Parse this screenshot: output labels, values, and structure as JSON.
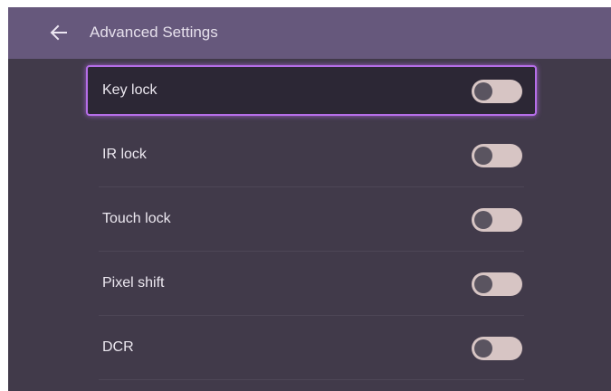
{
  "header": {
    "back_icon": "arrow-left-icon",
    "title": "Advanced Settings"
  },
  "settings": [
    {
      "label": "Key lock",
      "enabled": false,
      "focused": true
    },
    {
      "label": "IR lock",
      "enabled": false,
      "focused": false
    },
    {
      "label": "Touch lock",
      "enabled": false,
      "focused": false
    },
    {
      "label": "Pixel shift",
      "enabled": false,
      "focused": false
    },
    {
      "label": "DCR",
      "enabled": false,
      "focused": false
    }
  ],
  "colors": {
    "header_bg": "#66587c",
    "page_bg": "#413a4a",
    "focus_accent": "#b56ee8",
    "toggle_track": "#d7c5c4",
    "toggle_knob": "#5a5460"
  }
}
